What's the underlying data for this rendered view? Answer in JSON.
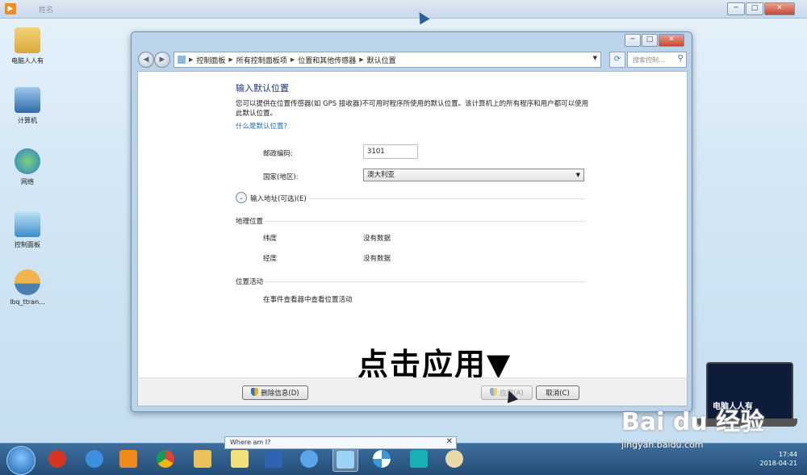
{
  "outer_window": {
    "title": "姓名",
    "controls": [
      "─",
      "□",
      "✕"
    ]
  },
  "desktop_icons": [
    {
      "label": "电脑人人有",
      "icon": "user-folder-icon"
    },
    {
      "label": "计算机",
      "icon": "computer-icon"
    },
    {
      "label": "网络",
      "icon": "network-icon"
    },
    {
      "label": "控制面板",
      "icon": "control-panel-icon"
    },
    {
      "label": "lbq_ttran...",
      "icon": "image-file-icon"
    }
  ],
  "dialog": {
    "controls": [
      "─",
      "□",
      "✕"
    ],
    "breadcrumb": [
      "控制面板",
      "所有控制面板项",
      "位置和其他传感器",
      "默认位置"
    ],
    "search_placeholder": "搜索控制...",
    "heading": "输入默认位置",
    "description": "您可以提供在位置传感器(如 GPS 接收器)不可用时程序所使用的默认位置。该计算机上的所有程序和用户都可以使用此默认位置。",
    "help_link": "什么是默认位置?",
    "postal_label": "邮政编码:",
    "postal_value": "3101",
    "country_label": "国家(地区):",
    "country_value": "澳大利亚",
    "address_expander": "输入地址(可选)(E)",
    "geo_section": "地理位置",
    "latitude_label": "纬度",
    "latitude_value": "没有数据",
    "longitude_label": "经度",
    "longitude_value": "没有数据",
    "activity_section": "位置活动",
    "activity_link": "在事件查看器中查看位置活动",
    "annotation": "点击应用▼",
    "clear_button": "删除信息(D)",
    "apply_button": "应用(A)",
    "cancel_button": "取消(C)"
  },
  "tooltip": {
    "text": "Where am I?",
    "close": "✕"
  },
  "taskbar": {
    "apps": [
      "start-orb",
      "jiang-app-icon",
      "internet-explorer-icon",
      "media-player-icon",
      "chrome-icon",
      "file-explorer-icon",
      "sticky-notes-icon",
      "word-icon",
      "ie-alt-icon",
      "control-panel-icon",
      "pinwheel-icon",
      "headset-icon",
      "paint-icon"
    ],
    "time": "17:44",
    "date": "2018-04-21"
  },
  "watermark": {
    "brand": "电脑人人有",
    "baidu": "Bai du 经验",
    "url": "jingyan.baidu.com"
  },
  "colors": {
    "heading": "#1e3287",
    "link": "#1f6fc4",
    "taskbar": "#2c5a87"
  }
}
